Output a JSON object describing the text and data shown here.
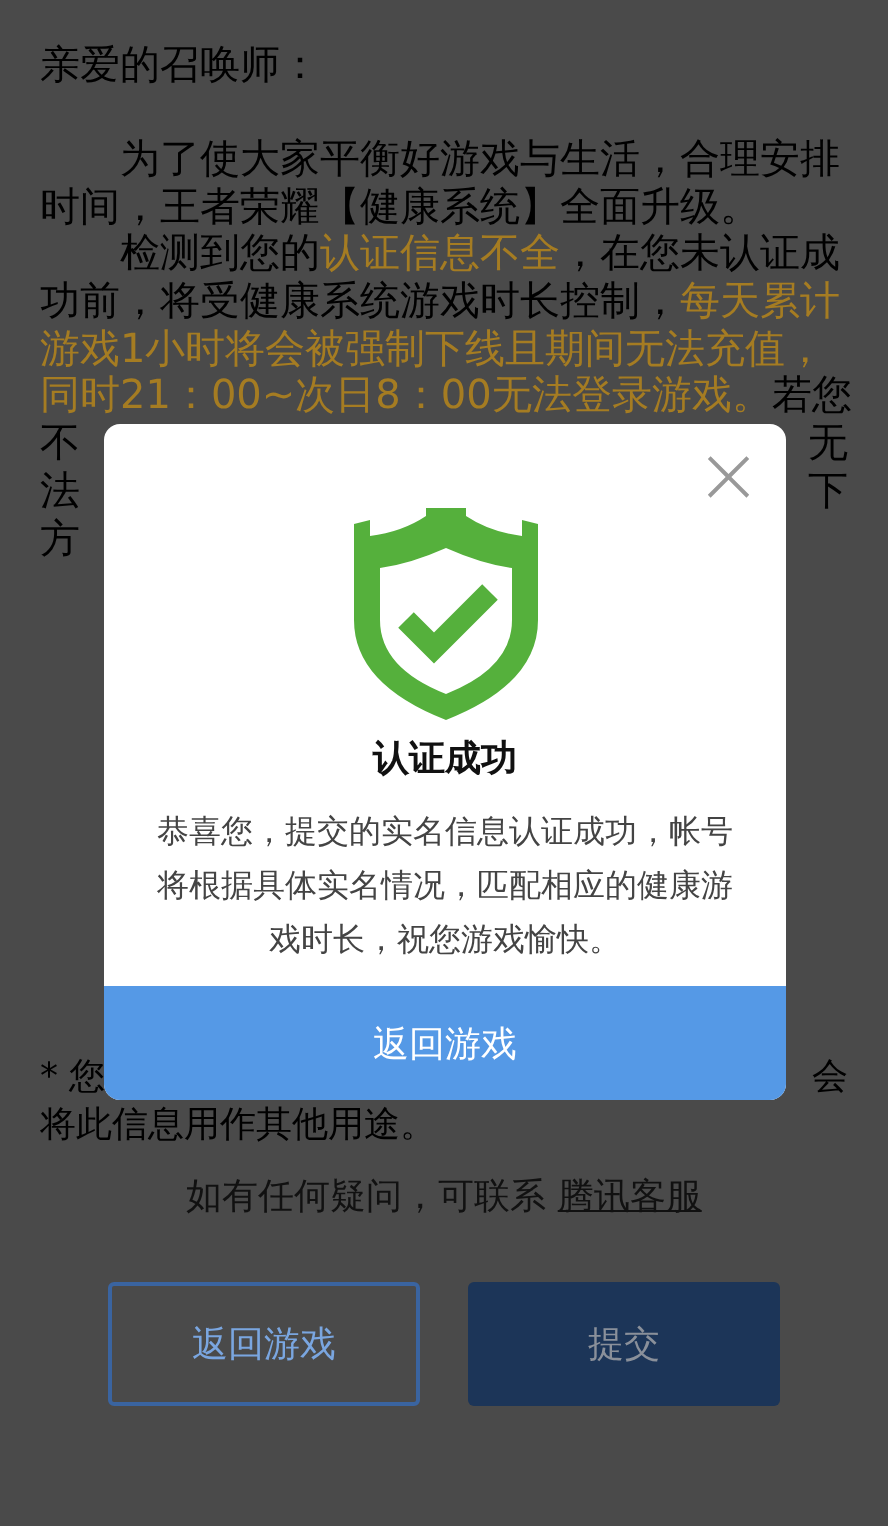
{
  "greeting": "亲爱的召唤师：",
  "notice_lines": [
    {
      "kind": "full",
      "indent": true,
      "segments": [
        {
          "text": "为了使大家平衡好游戏与生活，合理安排",
          "highlight": false
        }
      ]
    },
    {
      "kind": "full",
      "indent": false,
      "segments": [
        {
          "text": "时间，王者荣耀【健康系统】全面升级。",
          "highlight": false
        }
      ]
    },
    {
      "kind": "full",
      "indent": true,
      "segments": [
        {
          "text": "检测到您的",
          "highlight": false
        },
        {
          "text": "认证信息不全",
          "highlight": true
        },
        {
          "text": "，在您未认证成",
          "highlight": false
        }
      ]
    },
    {
      "kind": "full",
      "indent": false,
      "segments": [
        {
          "text": "功前，将受健康系统游戏时长控制，",
          "highlight": false
        },
        {
          "text": "每天累计",
          "highlight": true
        }
      ]
    },
    {
      "kind": "full",
      "indent": false,
      "segments": [
        {
          "text": "游戏1小时将会被强制下线且期间无法充值，",
          "highlight": true
        }
      ]
    },
    {
      "kind": "full",
      "indent": false,
      "segments": [
        {
          "text": "同时21：00~次日8：00无法登录游戏。",
          "highlight": true
        },
        {
          "text": "若您",
          "highlight": false
        }
      ]
    },
    {
      "kind": "split",
      "left": "不",
      "right": "无"
    },
    {
      "kind": "split",
      "left": "法",
      "right": "下"
    },
    {
      "kind": "split",
      "left": "方"
    }
  ],
  "footnote_lines": [
    {
      "kind": "split",
      "left": "* 您",
      "right": "会"
    },
    {
      "kind": "full",
      "indent": false,
      "segments": [
        {
          "text": "将此信息用作其他用途。",
          "highlight": false
        }
      ]
    }
  ],
  "contact": {
    "text": "如有任何疑问，可联系",
    "link": "腾讯客服"
  },
  "buttons": [
    {
      "label": "返回游戏",
      "kind": "outline"
    },
    {
      "label": "提交",
      "kind": "primary"
    }
  ],
  "dialog": {
    "title": "认证成功",
    "message": "恭喜您，提交的实名信息认证成功，帐号将根据具体实名情况，匹配相应的健康游戏时长，祝您游戏愉快。",
    "close": "×",
    "button": "返回游戏"
  }
}
